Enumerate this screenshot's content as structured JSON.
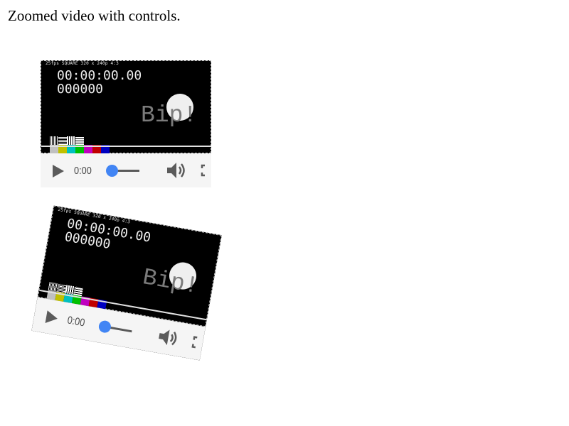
{
  "caption": "Zoomed video with controls.",
  "video": {
    "header_text": "25fps  SQUARE 320 x 240p 4:3",
    "timecode": "00:00:00.00",
    "framecount": "000000",
    "bip_text": "Bip!",
    "color_bars": [
      "#c0c0c0",
      "#c0c000",
      "#00c0c0",
      "#00c000",
      "#c000c0",
      "#c00000",
      "#0000c0"
    ],
    "accent_color": "#4285f4"
  },
  "controls": {
    "play_icon": "play-icon",
    "time_display": "0:00",
    "volume_icon": "volume-icon",
    "fullscreen_icon": "fullscreen-icon"
  },
  "second_player": {
    "rotation_deg": 10
  }
}
